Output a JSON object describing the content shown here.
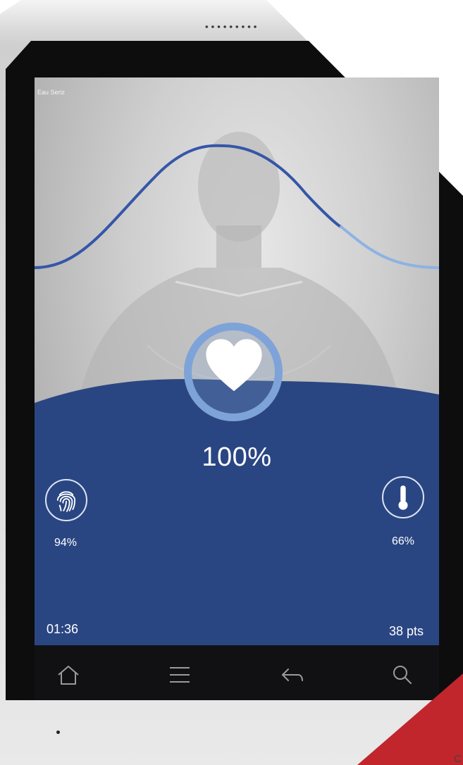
{
  "screen": {
    "header_text": "Eau Seriz"
  },
  "heart_rate": {
    "percent_label": "100%",
    "icon": "heart-icon"
  },
  "left_stat": {
    "icon": "fingerprint-icon",
    "value": "94%"
  },
  "right_stat": {
    "icon": "thermometer-icon",
    "value": "66%"
  },
  "footer": {
    "time": "01:36",
    "points": "38 pts"
  },
  "nav": [
    {
      "icon": "home-icon"
    },
    {
      "icon": "menu-icon"
    },
    {
      "icon": "back-icon"
    },
    {
      "icon": "search-icon"
    }
  ],
  "corner_letter": "C",
  "colors": {
    "panel_blue": "#2a4682",
    "ring_blue": "#7ea3d8",
    "wave_dark": "#3556a8",
    "wave_light": "#8db2e4"
  }
}
